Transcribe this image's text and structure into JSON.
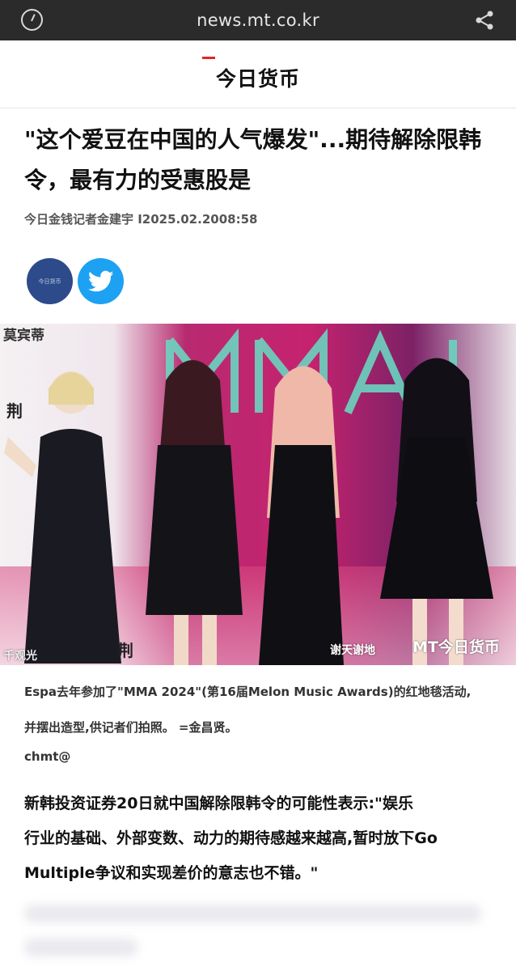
{
  "browser": {
    "url": "news.mt.co.kr"
  },
  "site": {
    "logo": "今日货币"
  },
  "article": {
    "headline": "\"这个爱豆在中国的人气爆发\"...期待解除限韩令，最有力的受惠股是",
    "byline": "今日金钱记者金建宇 I2025.02.2008:58",
    "social": {
      "mt_label": "今日货币"
    },
    "photo": {
      "watermark_tl": "莫宾蒂",
      "watermark_bl": "千观光",
      "watermark_br": "谢天谢地",
      "brand_br": "MT今日货币",
      "left_sign": "荆",
      "bottom_sign": "荆"
    },
    "caption_line1": "Espa去年参加了\"MMA 2024\"(第16届Melon Music Awards)的红地毯活动,",
    "caption_line2": "并摆出造型,供记者们拍照。 =金昌贤。",
    "author": "chmt@",
    "body_line1": "新韩投资证券20日就中国解除限韩令的可能性表示:\"娱乐",
    "body_line2": "行业的基础、外部变数、动力的期待感越来越高,暂时放下Go",
    "body_line3": "Multiple争议和实现差价的意志也不错。\""
  },
  "colors": {
    "accent": "#e3242b",
    "topbar": "#2b2b2b",
    "twitter": "#1da1f2",
    "mt_badge": "#2d4a8b"
  }
}
